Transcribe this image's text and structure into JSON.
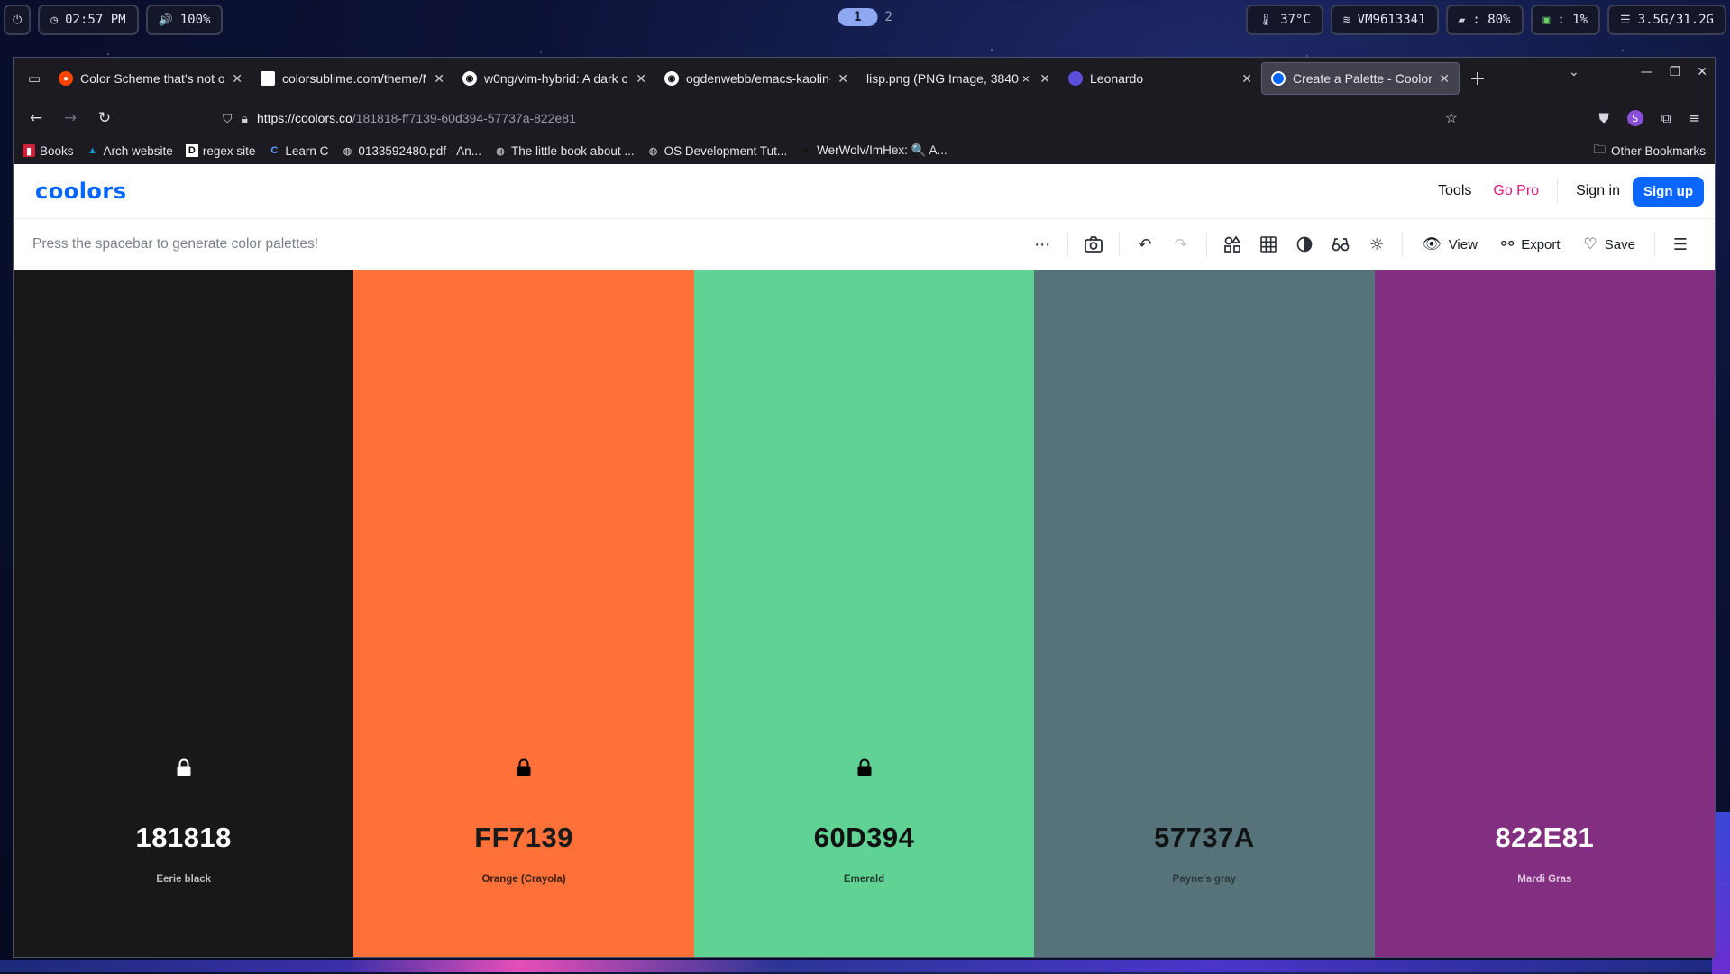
{
  "system_bar": {
    "power_icon": "power-icon",
    "clock": "02:57 PM",
    "volume": "100%",
    "workspaces": [
      "1",
      "2"
    ],
    "active_workspace": "1",
    "temperature": "37°C",
    "network": "VM9613341",
    "disk": ": 80%",
    "cpu": ": 1%",
    "memory": "3.5G/31.2G"
  },
  "browser": {
    "tabs": [
      {
        "title": "Color Scheme that's not on",
        "favicon": "reddit"
      },
      {
        "title": "colorsublime.com/theme/M",
        "favicon": "blank"
      },
      {
        "title": "w0ng/vim-hybrid: A dark c",
        "favicon": "github"
      },
      {
        "title": "ogdenwebb/emacs-kaolin-",
        "favicon": "github"
      },
      {
        "title": "lisp.png (PNG Image, 3840 × 2",
        "favicon": "none"
      },
      {
        "title": "Leonardo",
        "favicon": "leonardo"
      },
      {
        "title": "Create a Palette - Coolors",
        "favicon": "coolors",
        "active": true
      }
    ],
    "url": {
      "host": "https://coolors.co",
      "path": "/181818-ff7139-60d394-57737a-822e81"
    },
    "bookmarks": [
      {
        "label": "Books",
        "icon": "books-icon"
      },
      {
        "label": "Arch website",
        "icon": "arch-icon"
      },
      {
        "label": "regex site",
        "icon": "regex-icon"
      },
      {
        "label": "Learn C",
        "icon": "learn-c-icon"
      },
      {
        "label": "0133592480.pdf - An...",
        "icon": "globe-icon"
      },
      {
        "label": "The little book about ...",
        "icon": "globe-icon"
      },
      {
        "label": "OS Development Tut...",
        "icon": "globe-icon"
      },
      {
        "label": "WerWolv/ImHex: 🔍 A...",
        "icon": "github-icon"
      }
    ],
    "other_bookmarks": "Other Bookmarks"
  },
  "coolors": {
    "logo": "coolors",
    "nav": {
      "tools": "Tools",
      "go_pro": "Go Pro",
      "sign_in": "Sign in",
      "sign_up": "Sign up"
    },
    "hint": "Press the spacebar to generate color palettes!",
    "toolbar": {
      "view": "View",
      "export": "Export",
      "save": "Save"
    },
    "colors": [
      {
        "hex": "181818",
        "name": "Eerie black",
        "bg": "#181818",
        "fg": "#ffffff",
        "sub": "#bdbdbd",
        "locked": true
      },
      {
        "hex": "FF7139",
        "name": "Orange (Crayola)",
        "bg": "#FF7139",
        "fg": "#1a1a1a",
        "sub": "#3a2010",
        "locked": true
      },
      {
        "hex": "60D394",
        "name": "Emerald",
        "bg": "#60D394",
        "fg": "#111111",
        "sub": "#1f3d2c",
        "locked": true
      },
      {
        "hex": "57737A",
        "name": "Payne's gray",
        "bg": "#57737A",
        "fg": "#101416",
        "sub": "#2b3a3d",
        "locked": false
      },
      {
        "hex": "822E81",
        "name": "Mardi Gras",
        "bg": "#822E81",
        "fg": "#ffffff",
        "sub": "#e0c9df",
        "locked": false
      }
    ]
  }
}
